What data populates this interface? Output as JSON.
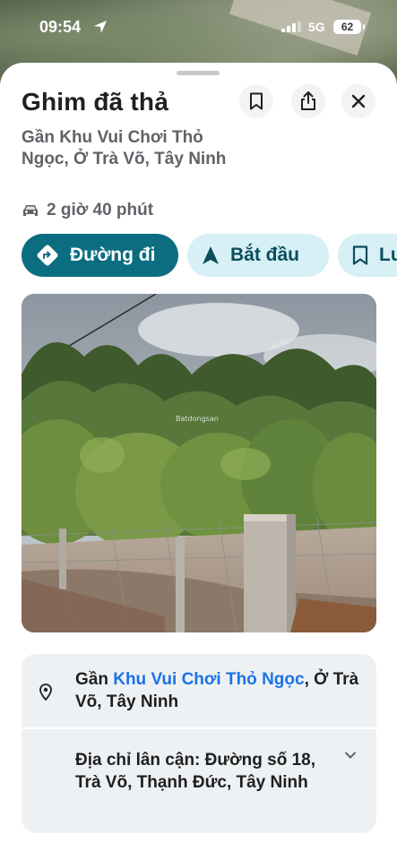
{
  "status_bar": {
    "time": "09:54",
    "network": "5G",
    "battery": "62"
  },
  "place": {
    "title": "Ghim đã thả",
    "subtitle": "Gần Khu Vui Chơi Thỏ Ngọc, Ở Trà Võ, Tây Ninh",
    "drive_time": "2 giờ 40 phút"
  },
  "actions": {
    "directions": "Đường đi",
    "start": "Bắt đầu",
    "save": "Lưu"
  },
  "photo": {
    "watermark": "Batdongsan"
  },
  "info": {
    "near_prefix": "Gần ",
    "near_link": "Khu Vui Chơi Thỏ Ngọc",
    "near_suffix": ", Ở Trà Võ, Tây Ninh",
    "nearby_address": "Địa chỉ lân cận: Đường số 18, Trà Võ, Thạnh Đức, Tây Ninh"
  },
  "colors": {
    "primary": "#0b6e80",
    "secondary_bg": "#d6f0f5",
    "link": "#1a73e8"
  }
}
